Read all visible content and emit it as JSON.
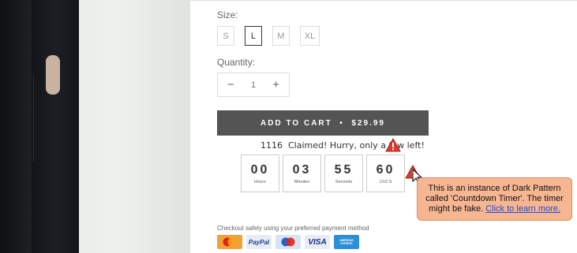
{
  "size": {
    "label": "Size:",
    "options": [
      "S",
      "L",
      "M",
      "XL"
    ],
    "selected": "L"
  },
  "quantity": {
    "label": "Quantity:",
    "minus": "−",
    "value": "1",
    "plus": "+"
  },
  "cart": {
    "button_label": "ADD TO CART  •  $29.99"
  },
  "scarcity": {
    "text": "1116  Claimed! Hurry, only a few left!"
  },
  "timer": {
    "hours": "00",
    "hours_unit": "Hours",
    "minutes": "03",
    "minutes_unit": "Minutes",
    "seconds": "55",
    "seconds_unit": "Seconds",
    "tenths": "60",
    "tenths_unit": "1/10 S"
  },
  "dark_pattern_tooltip": {
    "text": "This is an instance of Dark Pattern called 'Countdown Timer'. The timer might be fake.",
    "link": "Click to learn more."
  },
  "checkout": {
    "text": "Checkout safely using your preferred payment method",
    "methods": [
      "MasterCard",
      "PayPal",
      "Maestro",
      "VISA",
      "AMERICAN EXPRESS"
    ]
  },
  "colors": {
    "cart_button": "#545454",
    "tooltip_bg": "#f6b692",
    "warning": "#e03a2f",
    "link": "#1a4bd8"
  }
}
